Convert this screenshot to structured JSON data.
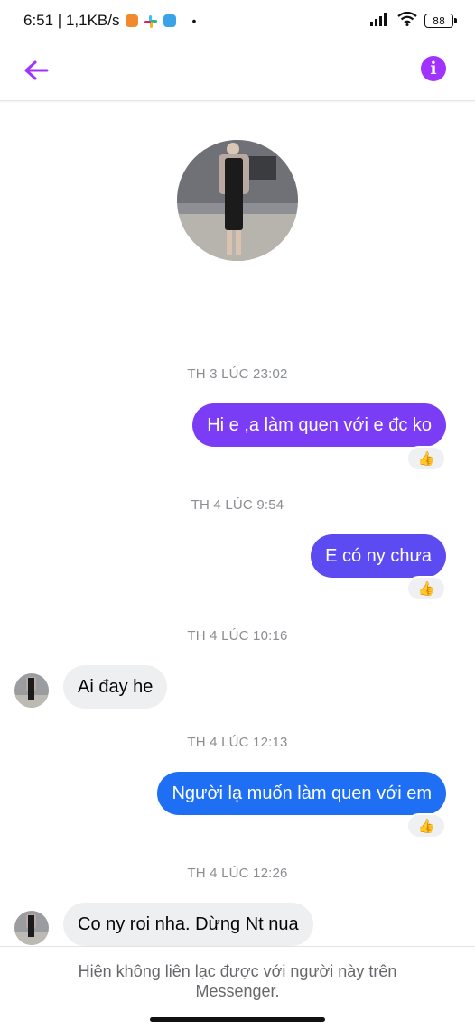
{
  "status_bar": {
    "time_speed": "6:51 | 1,1KB/s",
    "dot": "•",
    "battery": "88",
    "icons": [
      "orange-app-icon",
      "slack-icon",
      "blue-app-icon",
      "signal-icon",
      "wifi-icon",
      "battery-icon"
    ]
  },
  "header": {
    "back_icon": "arrow-left-icon",
    "info_icon": "info-circle-icon",
    "info_glyph": "i",
    "accent_color": "#a033ff"
  },
  "messages": [
    {
      "type": "time",
      "text": "TH 3 LÚC 23:02"
    },
    {
      "type": "out",
      "text": "Hi e ,a làm quen với e đc ko",
      "color": "#7b3cf5",
      "reaction": "👍"
    },
    {
      "type": "time",
      "text": "TH 4 LÚC 9:54"
    },
    {
      "type": "out",
      "text": "E có ny chưa",
      "color": "#5b4bf0",
      "reaction": "👍"
    },
    {
      "type": "time",
      "text": "TH 4 LÚC 10:16"
    },
    {
      "type": "in",
      "text": "Ai đay he"
    },
    {
      "type": "time",
      "text": "TH 4 LÚC 12:13"
    },
    {
      "type": "out",
      "text": "Người lạ muốn làm quen với em",
      "color": "#1f6ff5",
      "reaction": "👍"
    },
    {
      "type": "time",
      "text": "TH 4 LÚC 12:26"
    },
    {
      "type": "in",
      "text": "Co ny roi nha. Dừng Nt nua"
    }
  ],
  "footer": {
    "notice": "Hiện không liên lạc được với người này trên Messenger."
  }
}
